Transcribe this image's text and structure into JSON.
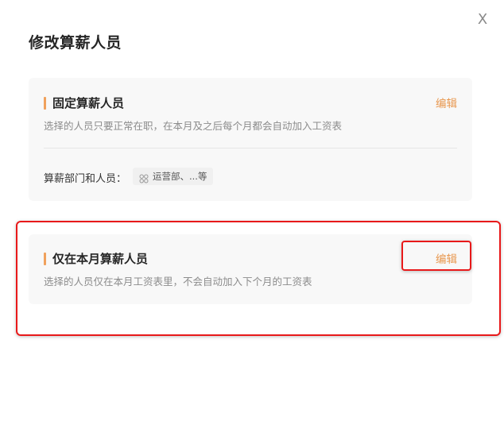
{
  "dialog": {
    "title": "修改算薪人员",
    "close_label": "X"
  },
  "fixed_section": {
    "title": "固定算薪人员",
    "description": "选择的人员只要正常在职，在本月及之后每个月都会自动加入工资表",
    "edit_label": "编辑",
    "scope_label": "算薪部门和人员：",
    "scope_value": "运营部、...等",
    "scope_icon": "department-icon"
  },
  "month_section": {
    "title": "仅在本月算薪人员",
    "description": "选择的人员仅在本月工资表里，不会自动加入下个月的工资表",
    "edit_label": "编辑"
  },
  "colors": {
    "accent": "#f0a15c",
    "edit_link": "#e8974e",
    "annotation": "#e8191a",
    "card_bg": "#f8f8f8"
  }
}
